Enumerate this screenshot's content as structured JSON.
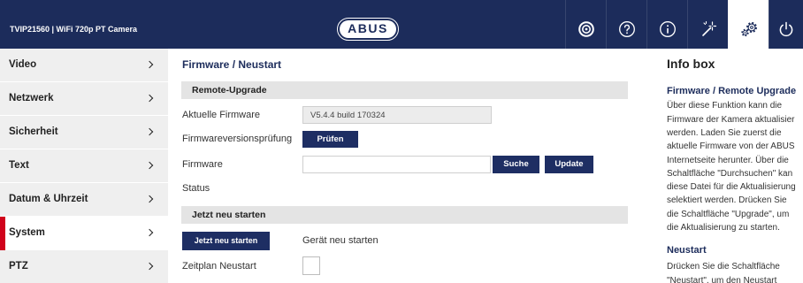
{
  "header": {
    "title": "TVIP21560 | WiFi 720p PT Camera",
    "logo_text": "ABUS",
    "icons": [
      {
        "name": "live-view-icon"
      },
      {
        "name": "help-icon"
      },
      {
        "name": "info-icon"
      },
      {
        "name": "wizard-wand-icon"
      },
      {
        "name": "settings-gears-icon",
        "active": true
      },
      {
        "name": "power-icon"
      }
    ]
  },
  "colors": {
    "header_bg": "#1c2c5b",
    "button_bg": "#1e2e63",
    "accent_red": "#d0021b",
    "section_bg": "#e4e4e4",
    "sidebar_bg": "#efefef",
    "title_color": "#1c2c5b"
  },
  "sidebar": {
    "items": [
      {
        "label": "Video",
        "icon": "chevron-right-icon"
      },
      {
        "label": "Netzwerk",
        "icon": "chevron-right-icon"
      },
      {
        "label": "Sicherheit",
        "icon": "chevron-right-icon"
      },
      {
        "label": "Text",
        "icon": "chevron-right-icon"
      },
      {
        "label": "Datum & Uhrzeit",
        "icon": "chevron-right-icon"
      },
      {
        "label": "System",
        "icon": "chevron-right-icon"
      },
      {
        "label": "PTZ",
        "icon": "chevron-right-icon"
      }
    ],
    "active_item": "System"
  },
  "main": {
    "title": "Firmware / Neustart",
    "remote_upgrade": {
      "heading": "Remote-Upgrade",
      "current_firmware_label": "Aktuelle Firmware",
      "current_firmware_value": "V5.4.4 build 170324",
      "version_check_label": "Firmwareversionsprüfung",
      "check_button": "Prüfen",
      "firmware_label": "Firmware",
      "browse_button": "Suche",
      "update_button": "Update",
      "status_label": "Status"
    },
    "restart": {
      "heading": "Jetzt neu starten",
      "restart_button": "Jetzt neu starten",
      "restart_description": "Gerät neu starten",
      "schedule_label": "Zeitplan Neustart",
      "schedule_checked": false
    }
  },
  "info_box": {
    "title": "Info box",
    "sections": [
      {
        "heading": "Firmware / Remote Upgrade",
        "lines": [
          "Über diese Funktion kann die",
          "Firmware der Kamera aktualisier",
          "werden. Laden Sie zuerst die",
          "aktuelle Firmware von der ABUS",
          "Internetseite herunter. Über die",
          "Schaltfläche \"Durchsuchen\" kan",
          "diese Datei für die Aktualisierung",
          "selektiert werden. Drücken Sie",
          "die Schaltfläche \"Upgrade\", um",
          "die Aktualisierung zu starten."
        ]
      },
      {
        "heading": "Neustart",
        "lines": [
          "Drücken Sie die Schaltfläche",
          "\"Neustart\", um den Neustart"
        ]
      }
    ]
  }
}
